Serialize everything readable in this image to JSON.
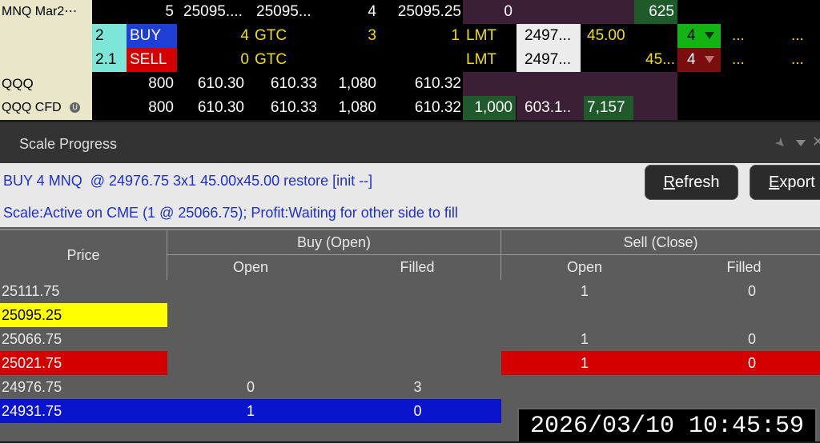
{
  "rows": {
    "mnq": {
      "symbol": "MNQ Mar2⋯",
      "c1": "5",
      "c2": "25095....",
      "c3": "25095...",
      "c4": "4",
      "c5": "25095.25",
      "c6": "0",
      "c7": "625"
    },
    "buy": {
      "id": "2",
      "side": "BUY",
      "qty": "4",
      "tif": "GTC",
      "c3": "3",
      "c4": "1",
      "type": "LMT",
      "price": "2497...",
      "aux": "45.00",
      "count": "4",
      "dots": "...",
      "dots2": "..."
    },
    "sell": {
      "id": "2.1",
      "side": "SELL",
      "qty": "0",
      "tif": "GTC",
      "type": "LMT",
      "price": "2497...",
      "aux": "45...",
      "count": "4",
      "dots": "...",
      "dots2": "..."
    },
    "qqq": {
      "symbol": "QQQ",
      "c1": "800",
      "c2": "610.30",
      "c3": "610.33",
      "c4": "1,080",
      "c5": "610.32"
    },
    "qqqcfd": {
      "symbol": "QQQ CFD",
      "c1": "800",
      "c2": "610.30",
      "c3": "610.33",
      "c4": "1,080",
      "c5": "610.32",
      "c6": "1,000",
      "c7": "603.1..",
      "c8": "7,157"
    }
  },
  "panel": {
    "title": "Scale Progress",
    "line1": "BUY 4 MNQ  @ 24976.75 3x1 45.00x45.00 restore [init --]",
    "line2": "Scale:Active on CME (1 @ 25066.75); Profit:Waiting for other side to fill",
    "refresh_first": "R",
    "refresh_rest": "efresh",
    "export_first": "E",
    "export_rest": "xport"
  },
  "grid": {
    "price_header": "Price",
    "buy_header": "Buy (Open)",
    "sell_header": "Sell (Close)",
    "open": "Open",
    "filled": "Filled",
    "rows": [
      {
        "price": "25111.75",
        "buy_open": "",
        "buy_filled": "",
        "sell_open": "1",
        "sell_filled": "0"
      },
      {
        "price": "25095.25",
        "buy_open": "",
        "buy_filled": "",
        "sell_open": "",
        "sell_filled": ""
      },
      {
        "price": "25066.75",
        "buy_open": "",
        "buy_filled": "",
        "sell_open": "1",
        "sell_filled": "0"
      },
      {
        "price": "25021.75",
        "buy_open": "",
        "buy_filled": "",
        "sell_open": "1",
        "sell_filled": "0"
      },
      {
        "price": "24976.75",
        "buy_open": "0",
        "buy_filled": "3",
        "sell_open": "",
        "sell_filled": ""
      },
      {
        "price": "24931.75",
        "buy_open": "1",
        "buy_filled": "0",
        "sell_open": "",
        "sell_filled": ""
      }
    ]
  },
  "timestamp": "2026/03/10 10:45:59"
}
